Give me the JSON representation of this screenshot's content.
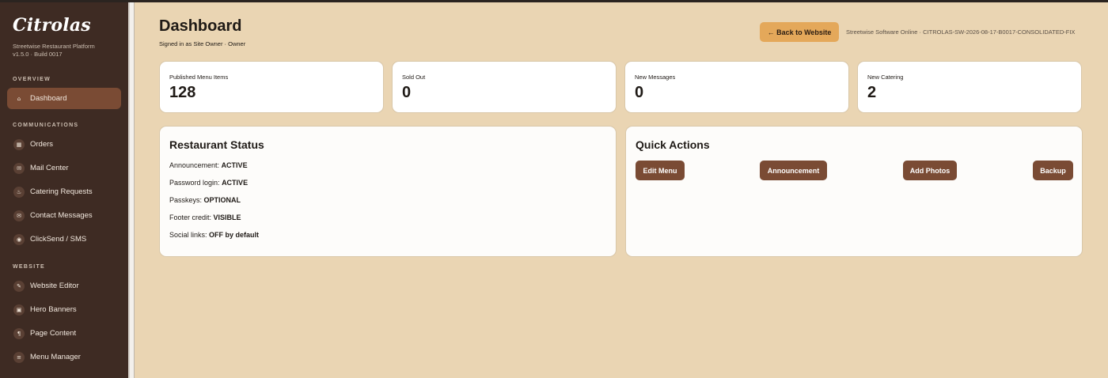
{
  "sidebar": {
    "brand": "Citrolas",
    "subtitle_line1": "Streetwise Restaurant Platform",
    "subtitle_line2": "v1.5.0 · Build 0017",
    "sections": [
      {
        "label": "OVERVIEW",
        "items": [
          {
            "label": "Dashboard",
            "icon": "home-icon",
            "glyph": "⌂",
            "active": true
          }
        ]
      },
      {
        "label": "COMMUNICATIONS",
        "items": [
          {
            "label": "Orders",
            "icon": "orders-icon",
            "glyph": "▦"
          },
          {
            "label": "Mail Center",
            "icon": "mail-icon",
            "glyph": "✉"
          },
          {
            "label": "Catering Requests",
            "icon": "catering-icon",
            "glyph": "♨"
          },
          {
            "label": "Contact Messages",
            "icon": "message-icon",
            "glyph": "✉"
          },
          {
            "label": "ClickSend / SMS",
            "icon": "sms-icon",
            "glyph": "◉"
          }
        ]
      },
      {
        "label": "WEBSITE",
        "items": [
          {
            "label": "Website Editor",
            "icon": "pencil-icon",
            "glyph": "✎"
          },
          {
            "label": "Hero Banners",
            "icon": "banner-icon",
            "glyph": "▣"
          },
          {
            "label": "Page Content",
            "icon": "paragraph-icon",
            "glyph": "¶"
          },
          {
            "label": "Menu Manager",
            "icon": "list-icon",
            "glyph": "≡"
          }
        ]
      }
    ]
  },
  "header": {
    "title": "Dashboard",
    "signed_in": "Signed in as Site Owner · Owner",
    "back_button": "← Back to Website",
    "status": "Streetwise Software Online · CITROLAS-SW-2026-08-17-B0017-CONSOLIDATED-FIX"
  },
  "stats": [
    {
      "label": "Published Menu Items",
      "value": "128"
    },
    {
      "label": "Sold Out",
      "value": "0"
    },
    {
      "label": "New Messages",
      "value": "0"
    },
    {
      "label": "New Catering",
      "value": "2"
    }
  ],
  "restaurant_status": {
    "title": "Restaurant Status",
    "lines": [
      {
        "label": "Announcement:",
        "value": "ACTIVE"
      },
      {
        "label": "Password login:",
        "value": "ACTIVE"
      },
      {
        "label": "Passkeys:",
        "value": "OPTIONAL"
      },
      {
        "label": "Footer credit:",
        "value": "VISIBLE"
      },
      {
        "label": "Social links:",
        "value": "OFF by default"
      }
    ]
  },
  "quick_actions": {
    "title": "Quick Actions",
    "buttons": [
      "Edit Menu",
      "Announcement",
      "Add Photos",
      "Backup"
    ]
  },
  "colors": {
    "background": "#ead5b3",
    "sidebar": "#3e2b23",
    "accent": "#7a4b34",
    "back_button": "#e4a85a"
  }
}
